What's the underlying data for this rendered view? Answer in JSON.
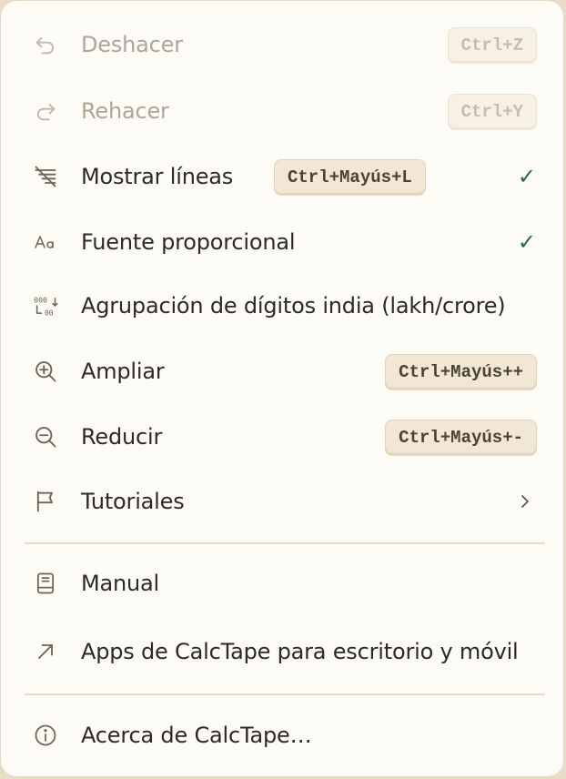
{
  "menu": {
    "items": [
      {
        "label": "Deshacer",
        "shortcut": "Ctrl+Z",
        "icon": "undo-icon",
        "disabled": true
      },
      {
        "label": "Rehacer",
        "shortcut": "Ctrl+Y",
        "icon": "redo-icon",
        "disabled": true
      },
      {
        "label": "Mostrar líneas",
        "shortcut": "Ctrl+Mayús+L",
        "icon": "lines-icon",
        "checked": true,
        "check": "✓"
      },
      {
        "label": "Fuente proporcional",
        "icon": "font-icon",
        "checked": true,
        "check": "✓"
      },
      {
        "label": "Agrupación de dígitos india (lakh/crore)",
        "icon": "digit-grouping-icon"
      },
      {
        "label": "Ampliar",
        "shortcut": "Ctrl+Mayús++",
        "icon": "zoom-in-icon"
      },
      {
        "label": "Reducir",
        "shortcut": "Ctrl+Mayús+-",
        "icon": "zoom-out-icon"
      },
      {
        "label": "Tutoriales",
        "icon": "flag-icon",
        "submenu": true
      }
    ],
    "help_items": [
      {
        "label": "Manual",
        "icon": "book-icon"
      },
      {
        "label": "Apps de CalcTape para escritorio y móvil",
        "icon": "external-link-icon"
      }
    ],
    "about_items": [
      {
        "label": "Acerca de CalcTape…",
        "icon": "info-icon"
      }
    ]
  },
  "colors": {
    "menu_background": "#fdfbf5",
    "text": "#2e2a22",
    "disabled_text": "#aea697",
    "check": "#1e6b5e",
    "shortcut_background": "#f2e6d4"
  }
}
